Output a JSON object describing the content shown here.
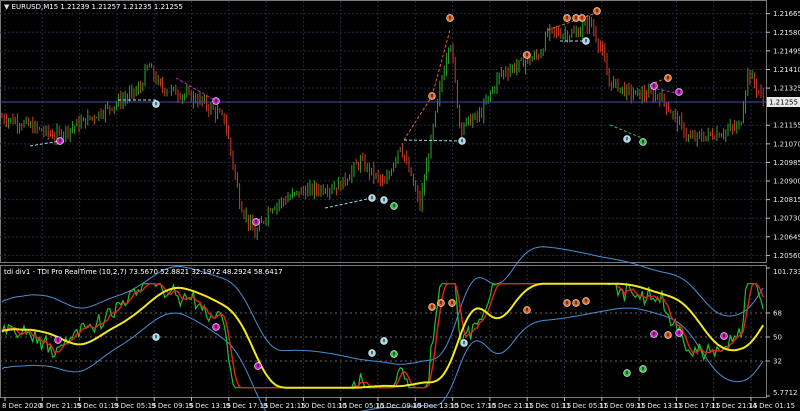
{
  "main": {
    "header": "EURUSD,M15  1.21239 1.21257 1.21235 1.21255",
    "current_price": "1.21255",
    "price_ticks": [
      "1.21665",
      "1.21580",
      "1.21495",
      "1.21410",
      "1.21325",
      "1.21155",
      "1.21070",
      "1.20985",
      "1.20900",
      "1.20815",
      "1.20730",
      "1.20645",
      "1.20560"
    ]
  },
  "indicator": {
    "header": "tdi div1 - TDI Pro RealTime (10,2,7) 73.5670 52.8821 32.1972 48.2924 58.6417",
    "levels": [
      "101.7333",
      "68",
      "50",
      "32",
      "5.7712"
    ]
  },
  "time_labels": [
    "8 Dec 2020",
    "8 Dec 21:15",
    "9 Dec 01:15",
    "9 Dec 05:15",
    "9 Dec 09:15",
    "9 Dec 13:15",
    "9 Dec 17:15",
    "9 Dec 21:15",
    "10 Dec 01:15",
    "10 Dec 05:15",
    "10 Dec 09:15",
    "10 Dec 13:15",
    "10 Dec 17:15",
    "10 Dec 21:15",
    "11 Dec 01:15",
    "11 Dec 05:15",
    "11 Dec 09:15",
    "11 Dec 13:15",
    "11 Dec 17:15",
    "11 Dec 21:15",
    "14 Dec 01:15"
  ],
  "colors": {
    "background": "#000000",
    "grid": "#1e2a44",
    "candle_up": "#2ea32e",
    "candle_down": "#d23c28",
    "price_line": "#3f4fa0",
    "bands": "#4a8ed6",
    "rsi_line": "#22c12a",
    "signal_line": "#e0241c",
    "base_line": "#f2e81e",
    "arrow_orange": "#e8641e",
    "arrow_magenta": "#d020d0",
    "arrow_cyan": "#9fd8e8",
    "arrow_green": "#2ec24a"
  }
}
